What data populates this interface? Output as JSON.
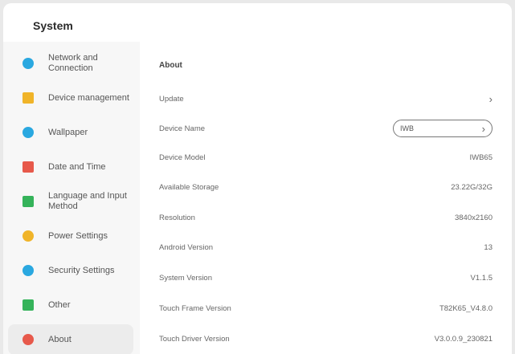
{
  "app": {
    "title": "System"
  },
  "sidebar": {
    "items": [
      {
        "label": "Network and Connection",
        "icon": "globe-icon",
        "color": "#2aa8e0"
      },
      {
        "label": "Device management",
        "icon": "speaker-icon",
        "color": "#f0b429"
      },
      {
        "label": "Wallpaper",
        "icon": "palette-icon",
        "color": "#2aa8e0"
      },
      {
        "label": "Date and Time",
        "icon": "calendar-icon",
        "color": "#e7594b"
      },
      {
        "label": "Language and Input Method",
        "icon": "keyboard-icon",
        "color": "#35b35a"
      },
      {
        "label": "Power Settings",
        "icon": "power-icon",
        "color": "#f0b429"
      },
      {
        "label": "Security Settings",
        "icon": "shield-icon",
        "color": "#2aa8e0"
      },
      {
        "label": "Other",
        "icon": "list-icon",
        "color": "#35b35a"
      },
      {
        "label": "About",
        "icon": "info-icon",
        "color": "#e7594b",
        "selected": true
      }
    ]
  },
  "about": {
    "title": "About",
    "rows": [
      {
        "label": "Update",
        "value": "",
        "chevron": true
      },
      {
        "label": "Device Name",
        "value": "IWB",
        "editable": true
      },
      {
        "label": "Device Model",
        "value": "IWB65"
      },
      {
        "label": "Available Storage",
        "value": "23.22G/32G"
      },
      {
        "label": "Resolution",
        "value": "3840x2160"
      },
      {
        "label": "Android Version",
        "value": "13"
      },
      {
        "label": "System Version",
        "value": "V1.1.5"
      },
      {
        "label": "Touch Frame Version",
        "value": "T82K65_V4.8.0"
      },
      {
        "label": "Touch Driver Version",
        "value": "V3.0.0.9_230821"
      }
    ]
  }
}
